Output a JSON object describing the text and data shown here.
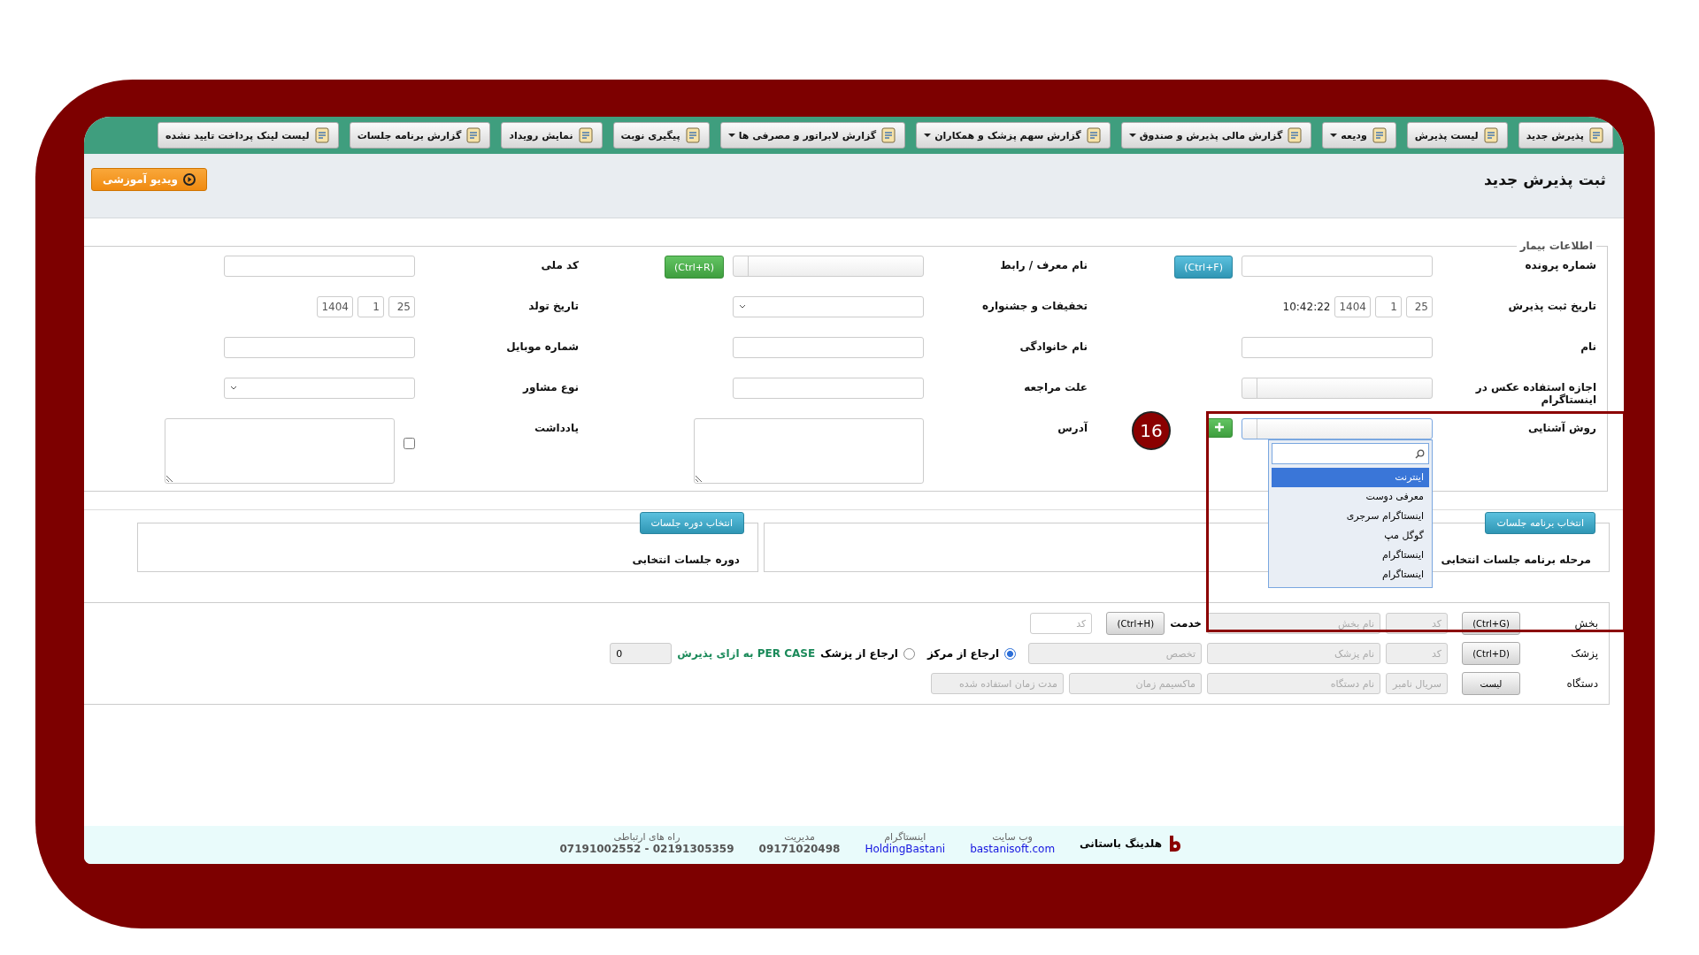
{
  "toolbar": [
    {
      "label": "پذیرش جدید",
      "has_menu": false
    },
    {
      "label": "لیست پذیرش",
      "has_menu": false
    },
    {
      "label": "ودیعه",
      "has_menu": true
    },
    {
      "label": "گزارش مالی پذیرش و صندوق",
      "has_menu": true
    },
    {
      "label": "گزارش سهم پزشک و همکاران",
      "has_menu": true
    },
    {
      "label": "گزارش لابراتور و مصرفی ها",
      "has_menu": true
    },
    {
      "label": "پیگیری نوبت",
      "has_menu": false
    },
    {
      "label": "نمایش رویداد",
      "has_menu": false
    },
    {
      "label": "گزارش برنامه جلسات",
      "has_menu": false
    },
    {
      "label": "لیست لینک پرداخت تایید نشده",
      "has_menu": false
    }
  ],
  "page_title": "ثبت پذیرش جدید",
  "video_button": "ویدیو آموزشی",
  "patient_info": {
    "legend": "اطلاعات بیمار",
    "rows": [
      [
        {
          "label": "شماره پرونده",
          "kind": "text_button",
          "button": "(Ctrl+F)"
        },
        {
          "label": "نام معرف / رابط",
          "kind": "combo_button",
          "button": "(Ctrl+R)"
        },
        {
          "label": "کد ملی",
          "kind": "text"
        }
      ],
      [
        {
          "label": "تاریخ ثبت پذیرش",
          "kind": "date",
          "day": "25",
          "month": "1",
          "year": "1404",
          "time": "10:42:22"
        },
        {
          "label": "تخفیفات و جشنواره",
          "kind": "select"
        },
        {
          "label": "تاریخ تولد",
          "kind": "date",
          "day": "25",
          "month": "1",
          "year": "1404"
        }
      ],
      [
        {
          "label": "نام",
          "kind": "text"
        },
        {
          "label": "نام خانوادگی",
          "kind": "text"
        },
        {
          "label": "شماره موبایل",
          "kind": "text"
        }
      ],
      [
        {
          "label": "اجازه استفاده عکس در اینستاگرام",
          "kind": "combo"
        },
        {
          "label": "علت مراجعه",
          "kind": "text"
        },
        {
          "label": "نوع مشاور",
          "kind": "select"
        }
      ],
      [
        {
          "label": "روش آشنایی",
          "kind": "combo_open"
        },
        {
          "label": "آدرس",
          "kind": "textarea"
        },
        {
          "label": "یادداشت",
          "kind": "note",
          "checked": false
        }
      ]
    ]
  },
  "referral_dropdown": {
    "options": [
      {
        "label": "اینترنت",
        "selected": true
      },
      {
        "label": "معرفی دوست",
        "selected": false
      },
      {
        "label": "اینستاگرام سرجری",
        "selected": false
      },
      {
        "label": "گوگل مپ",
        "selected": false
      },
      {
        "label": "اینستاگرام",
        "selected": false
      },
      {
        "label": "اینستاگرام",
        "selected": false
      }
    ]
  },
  "annotation": {
    "number": "16"
  },
  "sessions": [
    {
      "button": "انتخاب برنامه جلسات",
      "label": "مرحله برنامه جلسات انتخابی"
    },
    {
      "button": "انتخاب دوره جلسات",
      "label": "دوره جلسات انتخابی"
    }
  ],
  "services": {
    "department": {
      "label": "بخش",
      "button": "(Ctrl+G)",
      "code_placeholder": "کد",
      "name_placeholder": "نام بخش",
      "service_label": "خدمت",
      "service_button": "(Ctrl+H)",
      "service_code_placeholder": "کد"
    },
    "doctor": {
      "label": "پزشک",
      "button": "(Ctrl+D)",
      "code_placeholder": "کد",
      "name_placeholder": "نام پزشک",
      "specialty_placeholder": "تخصص",
      "referrals": [
        {
          "label": "ارجاع از مرکز",
          "selected": true
        },
        {
          "label": "ارجاع از پزشک",
          "selected": false
        }
      ],
      "per_case": "PER CASE به ازای پذیرش",
      "per_case_value": "0"
    },
    "device": {
      "label": "دستگاه",
      "button": "لیست",
      "placeholders": [
        "سریال نامبر",
        "نام دستگاه",
        "ماکسیمم زمان",
        "مدت زمان استفاده شده"
      ]
    }
  },
  "footer": {
    "brand": "هلدینگ باستانی",
    "contacts": [
      {
        "title": "وب سایت",
        "value": "bastanisoft.com",
        "kind": "link"
      },
      {
        "title": "اینستاگرام",
        "value": "HoldingBastani",
        "kind": "link"
      },
      {
        "title": "مدیریت",
        "value": "09171020498",
        "kind": "plain"
      },
      {
        "title": "راه های ارتباطی",
        "value": "07191002552 - 02191305359",
        "kind": "plain"
      }
    ]
  }
}
